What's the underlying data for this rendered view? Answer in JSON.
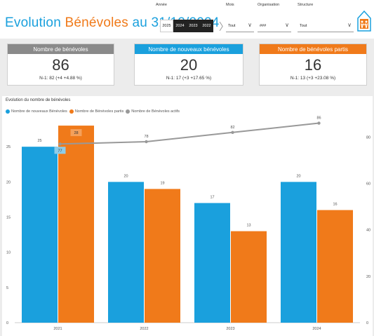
{
  "header": {
    "title_main": "Evolution ",
    "title_highlight": "Bénévoles",
    "title_end": " au 31/12/2024",
    "filters": {
      "annee_label": "Année",
      "years": [
        "2025",
        "2024",
        "2023",
        "2022"
      ],
      "selected_years": [
        "2024",
        "2023",
        "2022"
      ],
      "mois_label": "Mois",
      "mois_value": "Tout",
      "organisation_label": "Organisation",
      "organisation_value": "###",
      "structure_label": "Structure",
      "structure_value": "Tout"
    }
  },
  "kpis": [
    {
      "label": "Nombre de bénévoles",
      "value": "86",
      "sub": "N-1: 82 (+4 +4.88 %)",
      "color": "#8a8a8a"
    },
    {
      "label": "Nombre de nouveaux bénévoles",
      "value": "20",
      "sub": "N-1: 17 (+3 +17.65 %)",
      "color": "#1aa0dd"
    },
    {
      "label": "Nombre de bénévoles partis",
      "value": "16",
      "sub": "N-1: 13 (+3 +23.08 %)",
      "color": "#f07a1a"
    }
  ],
  "chart_title": "Evolution du nombre de bénévoles",
  "legend": [
    {
      "name": "Nombre de nouveaux Bénévoles",
      "color": "#1aa0dd"
    },
    {
      "name": "Nombre de Bénévoles partis",
      "color": "#f07a1a"
    },
    {
      "name": "Nombre de Bénévoles actifs",
      "color": "#999999"
    }
  ],
  "chart_data": {
    "type": "bar",
    "title": "Evolution du nombre de bénévoles",
    "categories": [
      "2021",
      "2022",
      "2023",
      "2024"
    ],
    "series": [
      {
        "name": "Nombre de nouveaux Bénévoles",
        "type": "bar",
        "axis": "left",
        "color": "#1aa0dd",
        "values": [
          25,
          20,
          17,
          20
        ]
      },
      {
        "name": "Nombre de Bénévoles partis",
        "type": "bar",
        "axis": "left",
        "color": "#f07a1a",
        "values": [
          28,
          19,
          13,
          16
        ]
      },
      {
        "name": "Nombre de Bénévoles actifs",
        "type": "line",
        "axis": "right",
        "color": "#999999",
        "values": [
          77,
          78,
          82,
          86
        ]
      }
    ],
    "y_left_ticks": [
      0,
      5,
      10,
      15,
      20,
      25
    ],
    "y_right_ticks": [
      0,
      20,
      40,
      60,
      80
    ],
    "ylim_left": [
      0,
      30
    ],
    "ylim_right": [
      0,
      91
    ],
    "legend_position": "top-left",
    "grid": false
  }
}
